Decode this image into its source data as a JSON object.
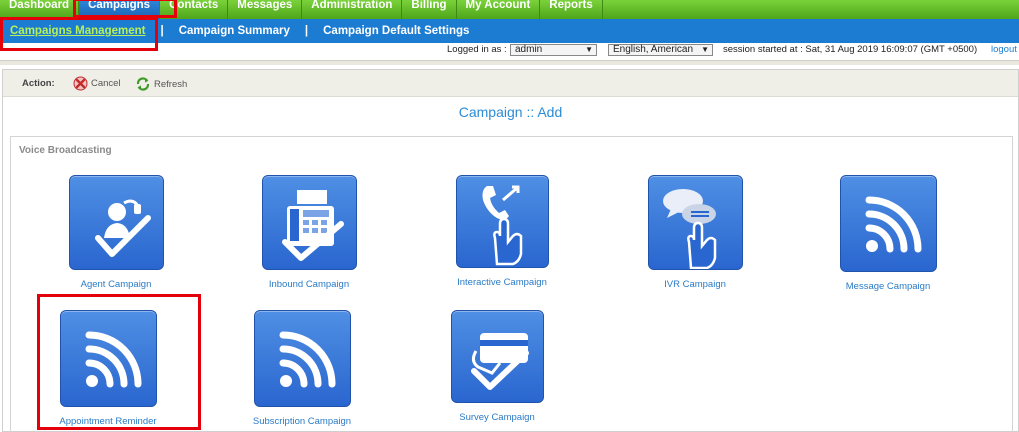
{
  "top_nav": {
    "items": [
      {
        "label": "Dashboard"
      },
      {
        "label": "Campaigns",
        "active": true
      },
      {
        "label": "Contacts"
      },
      {
        "label": "Messages"
      },
      {
        "label": "Administration"
      },
      {
        "label": "Billing"
      },
      {
        "label": "My Account"
      },
      {
        "label": "Reports"
      }
    ]
  },
  "sub_nav": {
    "items": [
      {
        "label": "Campaigns Management",
        "active": true
      },
      {
        "label": "Campaign Summary"
      },
      {
        "label": "Campaign Default Settings"
      }
    ],
    "separator": "|"
  },
  "session": {
    "logged_in_label": "Logged in as :",
    "user_value": "admin",
    "language_value": "English, American",
    "session_text": "session started at : Sat, 31 Aug 2019 16:09:07 (GMT +0500)",
    "logout_label": "logout"
  },
  "action_bar": {
    "label": "Action:",
    "cancel_label": "Cancel",
    "refresh_label": "Refresh"
  },
  "page_title": "Campaign :: Add",
  "group": {
    "title": "Voice Broadcasting",
    "tiles": [
      {
        "label": "Agent Campaign",
        "icon": "agent-headset-check-icon"
      },
      {
        "label": "Inbound Campaign",
        "icon": "fax-phone-check-icon"
      },
      {
        "label": "Interactive Campaign",
        "icon": "phone-hand-icon"
      },
      {
        "label": "IVR Campaign",
        "icon": "chat-hand-icon"
      },
      {
        "label": "Message Campaign",
        "icon": "broadcast-waves-icon"
      },
      {
        "label": "Appointment Reminder",
        "icon": "broadcast-waves-icon"
      },
      {
        "label": "Subscription Campaign",
        "icon": "broadcast-waves-icon"
      },
      {
        "label": "Survey Campaign",
        "icon": "card-check-icon"
      }
    ]
  },
  "colors": {
    "nav_green": "#4fa51a",
    "nav_blue": "#1c7cd2",
    "tile_blue": "#2a66cf",
    "link_blue": "#2a7bc6",
    "highlight_red": "#e3000b"
  }
}
